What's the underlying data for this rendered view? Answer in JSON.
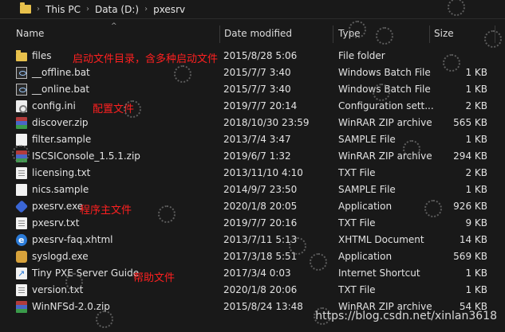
{
  "breadcrumb": [
    "This PC",
    "Data (D:)",
    "pxesrv"
  ],
  "columns": {
    "name": "Name",
    "date": "Date modified",
    "type": "Type",
    "size": "Size"
  },
  "files": [
    {
      "name": "files",
      "date": "2015/8/28 5:06",
      "type": "File folder",
      "size": "",
      "icon": "folder-icon"
    },
    {
      "name": "__offline.bat",
      "date": "2015/7/7 3:40",
      "type": "Windows Batch File",
      "size": "1 KB",
      "icon": "batch-file-icon"
    },
    {
      "name": "__online.bat",
      "date": "2015/7/7 3:40",
      "type": "Windows Batch File",
      "size": "1 KB",
      "icon": "batch-file-icon"
    },
    {
      "name": "config.ini",
      "date": "2019/7/7 20:14",
      "type": "Configuration sett...",
      "size": "2 KB",
      "icon": "config-file-icon"
    },
    {
      "name": "discover.zip",
      "date": "2018/10/30 23:59",
      "type": "WinRAR ZIP archive",
      "size": "565 KB",
      "icon": "zip-archive-icon"
    },
    {
      "name": "filter.sample",
      "date": "2013/7/4 3:47",
      "type": "SAMPLE File",
      "size": "1 KB",
      "icon": "file-icon"
    },
    {
      "name": "ISCSIConsole_1.5.1.zip",
      "date": "2019/6/7 1:32",
      "type": "WinRAR ZIP archive",
      "size": "294 KB",
      "icon": "zip-archive-icon"
    },
    {
      "name": "licensing.txt",
      "date": "2013/11/10 4:10",
      "type": "TXT File",
      "size": "2 KB",
      "icon": "text-file-icon"
    },
    {
      "name": "nics.sample",
      "date": "2014/9/7 23:50",
      "type": "SAMPLE File",
      "size": "1 KB",
      "icon": "file-icon"
    },
    {
      "name": "pxesrv.exe",
      "date": "2020/1/8 20:05",
      "type": "Application",
      "size": "926 KB",
      "icon": "application-icon"
    },
    {
      "name": "pxesrv.txt",
      "date": "2019/7/7 20:16",
      "type": "TXT File",
      "size": "9 KB",
      "icon": "text-file-icon"
    },
    {
      "name": "pxesrv-faq.xhtml",
      "date": "2013/7/11 5:13",
      "type": "XHTML Document",
      "size": "14 KB",
      "icon": "xhtml-document-icon"
    },
    {
      "name": "syslogd.exe",
      "date": "2017/3/18 5:51",
      "type": "Application",
      "size": "569 KB",
      "icon": "syslog-app-icon"
    },
    {
      "name": "Tiny PXE Server Guide",
      "date": "2017/3/4 0:03",
      "type": "Internet Shortcut",
      "size": "1 KB",
      "icon": "internet-shortcut-icon"
    },
    {
      "name": "version.txt",
      "date": "2020/1/8 20:06",
      "type": "TXT File",
      "size": "1 KB",
      "icon": "text-file-icon"
    },
    {
      "name": "WinNFSd-2.0.zip",
      "date": "2015/8/24 13:48",
      "type": "WinRAR ZIP archive",
      "size": "54 KB",
      "icon": "zip-archive-icon"
    }
  ],
  "annotations": {
    "files": "启动文件目录，含多种启动文件",
    "config": "配置文件",
    "main": "程序主文件",
    "help": "帮助文件"
  },
  "watermark": "https://blog.csdn.net/xinlan3618",
  "colors": {
    "annotation": "#ff2020",
    "folder": "#e8c14c",
    "background": "#191919"
  }
}
